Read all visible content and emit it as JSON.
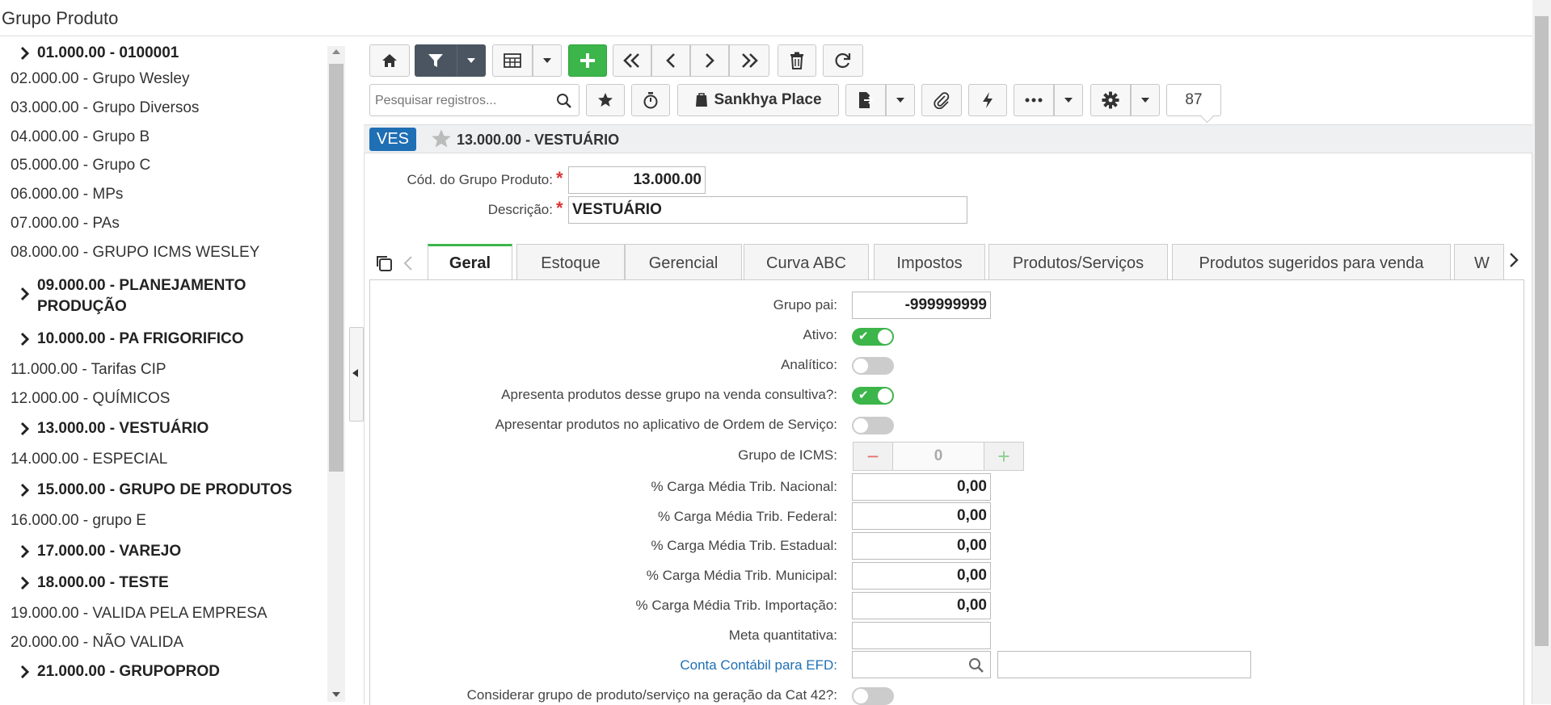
{
  "app": {
    "title": "Grupo Produto"
  },
  "tree": {
    "items": [
      {
        "label": "01.000.00 - 0100001",
        "group": true
      },
      {
        "label": "02.000.00 - Grupo Wesley",
        "group": false
      },
      {
        "label": "03.000.00 - Grupo Diversos",
        "group": false
      },
      {
        "label": "04.000.00 - Grupo B",
        "group": false
      },
      {
        "label": "05.000.00 - Grupo C",
        "group": false
      },
      {
        "label": "06.000.00 - MPs",
        "group": false
      },
      {
        "label": "07.000.00 - PAs",
        "group": false
      },
      {
        "label": "08.000.00 - GRUPO ICMS WESLEY",
        "group": false
      },
      {
        "label": "09.000.00 - PLANEJAMENTO PRODUÇÃO",
        "group": true
      },
      {
        "label": "10.000.00 - PA FRIGORIFICO",
        "group": true
      },
      {
        "label": "11.000.00 - Tarifas CIP",
        "group": false
      },
      {
        "label": "12.000.00 - QUÍMICOS",
        "group": false
      },
      {
        "label": "13.000.00 - VESTUÁRIO",
        "group": true
      },
      {
        "label": "14.000.00 - ESPECIAL",
        "group": false
      },
      {
        "label": "15.000.00 - GRUPO DE PRODUTOS",
        "group": true
      },
      {
        "label": "16.000.00 - grupo E",
        "group": false
      },
      {
        "label": "17.000.00 - VAREJO",
        "group": true
      },
      {
        "label": "18.000.00 - TESTE",
        "group": true
      },
      {
        "label": "19.000.00 - VALIDA PELA EMPRESA",
        "group": false
      },
      {
        "label": "20.000.00 - NÃO VALIDA",
        "group": false
      },
      {
        "label": "21.000.00 - GRUPOPROD",
        "group": true
      }
    ]
  },
  "toolbar": {
    "search_placeholder": "Pesquisar registros...",
    "sankhya_place_label": "Sankhya Place",
    "record_count": "87"
  },
  "record": {
    "badge": "VES",
    "title": "13.000.00 - VESTUÁRIO"
  },
  "form": {
    "cod_label": "Cód. do Grupo Produto:",
    "cod_value": "13.000.00",
    "desc_label": "Descrição:",
    "desc_value": "VESTUÁRIO",
    "required_mark": "*"
  },
  "tabs": [
    {
      "label": "Geral",
      "active": true
    },
    {
      "label": "Estoque"
    },
    {
      "label": "Gerencial"
    },
    {
      "label": "Curva ABC"
    },
    {
      "label": "Impostos"
    },
    {
      "label": "Produtos/Serviços"
    },
    {
      "label": "Produtos sugeridos para venda"
    },
    {
      "label": "W"
    }
  ],
  "geral": {
    "grupo_pai_label": "Grupo pai:",
    "grupo_pai_value": "-999999999",
    "ativo_label": "Ativo:",
    "ativo_on": true,
    "analitico_label": "Analítico:",
    "analitico_on": false,
    "venda_consultiva_label": "Apresenta produtos desse grupo na venda consultiva?:",
    "venda_consultiva_on": true,
    "ordem_servico_label": "Apresentar produtos no aplicativo de Ordem de Serviço:",
    "ordem_servico_on": false,
    "grupo_icms_label": "Grupo de ICMS:",
    "grupo_icms_value": "0",
    "trib_nacional_label": "% Carga Média Trib. Nacional:",
    "trib_nacional_value": "0,00",
    "trib_federal_label": "% Carga Média Trib. Federal:",
    "trib_federal_value": "0,00",
    "trib_estadual_label": "% Carga Média Trib. Estadual:",
    "trib_estadual_value": "0,00",
    "trib_municipal_label": "% Carga Média Trib. Municipal:",
    "trib_municipal_value": "0,00",
    "trib_importacao_label": "% Carga Média Trib. Importação:",
    "trib_importacao_value": "0,00",
    "meta_label": "Meta quantitativa:",
    "meta_value": "",
    "conta_label": "Conta Contábil para EFD:",
    "conta_value": "",
    "cat42_label": "Considerar grupo de produto/serviço na geração da Cat 42?:",
    "cat42_on": false
  },
  "colors": {
    "accent_green": "#3cb54a",
    "badge_blue": "#1f6fb5",
    "link_blue": "#1f6fb5",
    "required_red": "#d33"
  }
}
